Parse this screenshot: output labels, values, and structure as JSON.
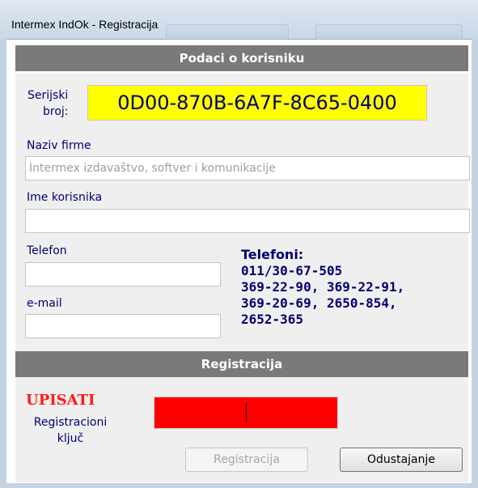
{
  "window": {
    "title": "Intermex IndOk - Registracija"
  },
  "user_section": {
    "header": "Podaci o korisniku",
    "serial_label_1": "Serijski",
    "serial_label_2": "broj:",
    "serial_value": "0D00-870B-6A7F-8C65-0400",
    "company_label": "Naziv firme",
    "company_placeholder": "Intermex izdavaštvo, softver i komunikacije",
    "company_value": "",
    "username_label": "Ime korisnika",
    "username_value": "",
    "phone_label": "Telefon",
    "phone_value": "",
    "email_label": "e-mail",
    "email_value": ""
  },
  "phones": {
    "heading": "Telefoni:",
    "lines": [
      "011/30-67-505",
      "369-22-90, 369-22-91,",
      "369-20-69, 2650-854,",
      "2652-365"
    ]
  },
  "registration_section": {
    "header": "Registracija",
    "prompt": "UPISATI",
    "key_label_1": "Registracioni",
    "key_label_2": "ključ",
    "key_value": "",
    "register_button": "Registracija",
    "cancel_button": "Odustajanje"
  },
  "colors": {
    "serial_bg": "#ffff00",
    "key_bg": "#ff0000",
    "label_color": "#00006e",
    "prompt_color": "#ff1a1a",
    "header_bg": "#7a7a7a"
  }
}
